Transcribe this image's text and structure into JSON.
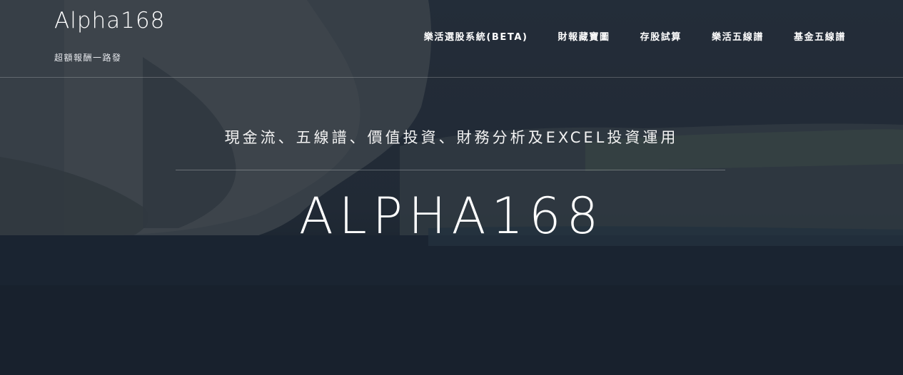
{
  "header": {
    "brand_title": "Alpha168",
    "brand_tagline": "超額報酬一路發",
    "nav": [
      {
        "label": "樂活選股系統(BETA)"
      },
      {
        "label": "財報藏寶圖"
      },
      {
        "label": "存股試算"
      },
      {
        "label": "樂活五線譜"
      },
      {
        "label": "基金五線譜"
      }
    ]
  },
  "hero": {
    "subtitle": "現金流、五線譜、價值投資、財務分析及EXCEL投資運用",
    "title": "ALPHA168"
  },
  "colors": {
    "text": "#ffffff",
    "overlay": "#1f2733",
    "divider": "#5a6270"
  }
}
